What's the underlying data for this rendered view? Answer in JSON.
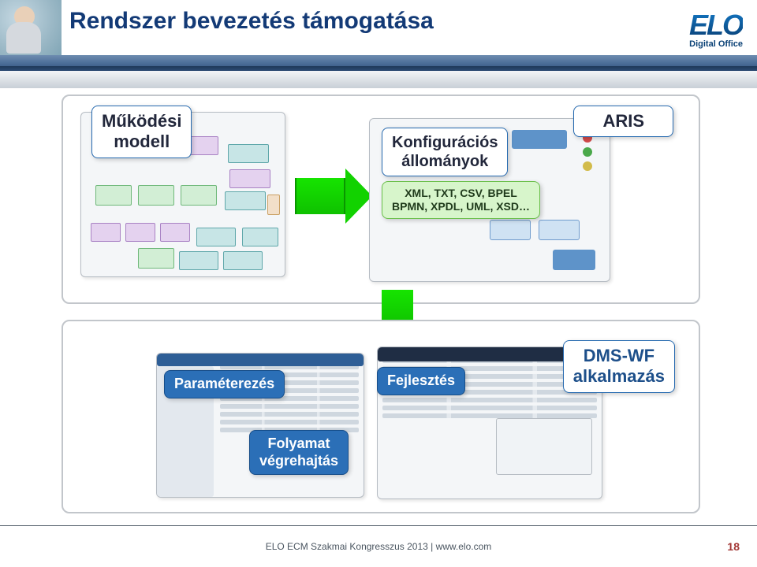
{
  "header": {
    "title": "Rendszer bevezetés támogatása",
    "logo_brand": "ELO",
    "logo_sub": "Digital Office"
  },
  "labels": {
    "mukodesi_modell_l1": "Működési",
    "mukodesi_modell_l2": "modell",
    "aris": "ARIS",
    "konfig_l1": "Konfigurációs",
    "konfig_l2": "állományok",
    "formats_l1": "XML, TXT, CSV, BPEL",
    "formats_l2": "BPMN, XPDL, UML, XSD…",
    "parameterezes": "Paraméterezés",
    "fejlesztes": "Fejlesztés",
    "folyamat_l1": "Folyamat",
    "folyamat_l2": "végrehajtás",
    "dmswf_l1": "DMS-WF",
    "dmswf_l2": "alkalmazás"
  },
  "footer": {
    "text": "ELO ECM Szakmai Kongresszus 2013  |  www.elo.com",
    "page": "18"
  }
}
